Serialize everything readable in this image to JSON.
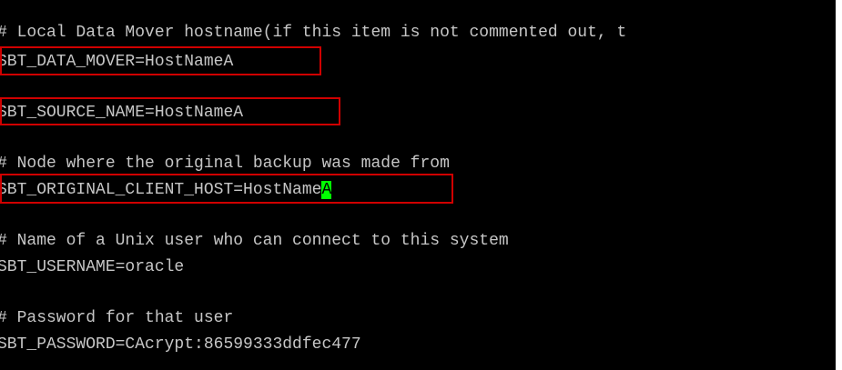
{
  "lines": {
    "comment_mover": "# Local Data Mover hostname(if this item is not commented out, t",
    "data_mover": "SBT_DATA_MOVER=HostNameA",
    "source_name": "SBT_SOURCE_NAME=HostNameA",
    "comment_node": "# Node where the original backup was made from",
    "original_client_prefix": "SBT_ORIGINAL_CLIENT_HOST=HostName",
    "original_client_cursor_char": "A",
    "comment_user": "# Name of a Unix user who can connect to this system",
    "username": "SBT_USERNAME=oracle",
    "comment_password": "# Password for that user",
    "password": "SBT_PASSWORD=CAcrypt:86599333ddfec477"
  },
  "colors": {
    "background": "#000000",
    "text": "#c6c6c6",
    "cursor": "#00ff00",
    "highlight_box": "#d00000"
  }
}
